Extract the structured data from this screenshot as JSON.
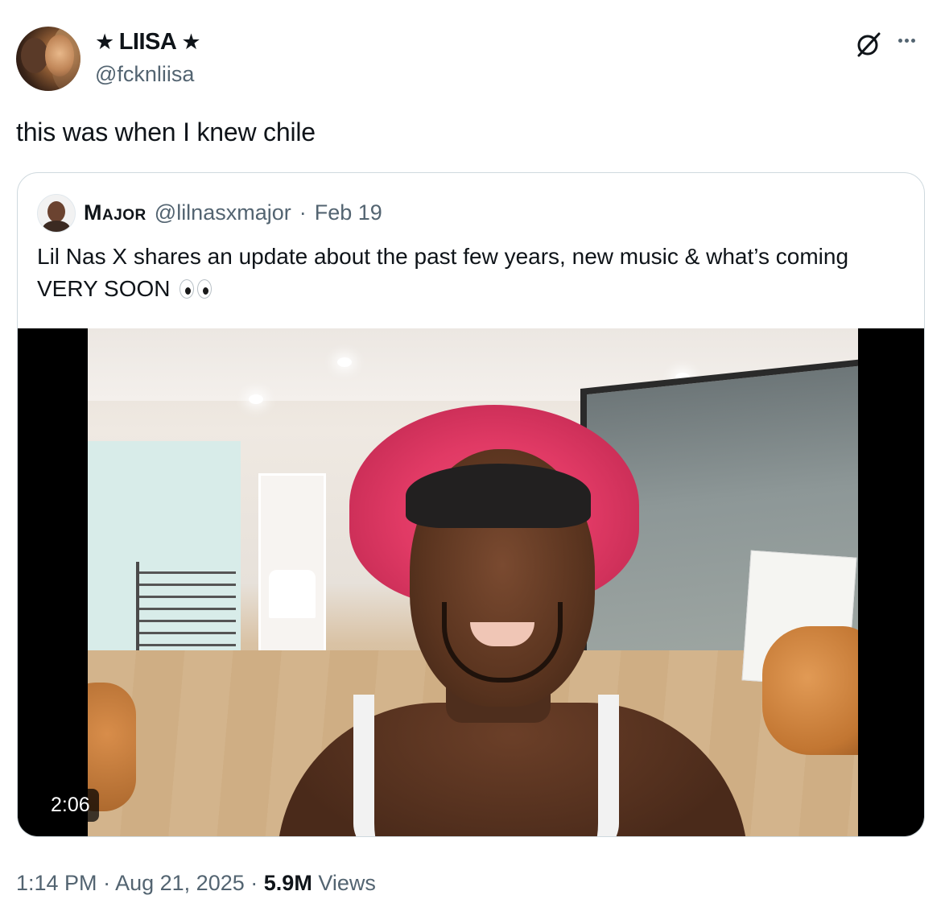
{
  "author": {
    "display_name": "LIISA",
    "name_decoration": "★",
    "handle": "@fcknliisa"
  },
  "icons": {
    "grok": "grok-icon",
    "more": "more-icon"
  },
  "tweet": {
    "text": "this was when I knew chile",
    "time": "1:14 PM",
    "separator": "·",
    "date": "Aug 21, 2025",
    "views_count": "5.9M",
    "views_label": "Views"
  },
  "quote": {
    "name": "Major",
    "handle": "@lilnasxmajor",
    "date": "Feb 19",
    "text": "Lil Nas X shares an update about the past few years, new music & what’s coming VERY SOON",
    "emoji": "eyes-emoji",
    "video_duration": "2:06"
  },
  "colors": {
    "text_primary": "#0f1419",
    "text_secondary": "#536471",
    "border": "#cfd9de",
    "bonnet_pink": "#e13a65"
  }
}
